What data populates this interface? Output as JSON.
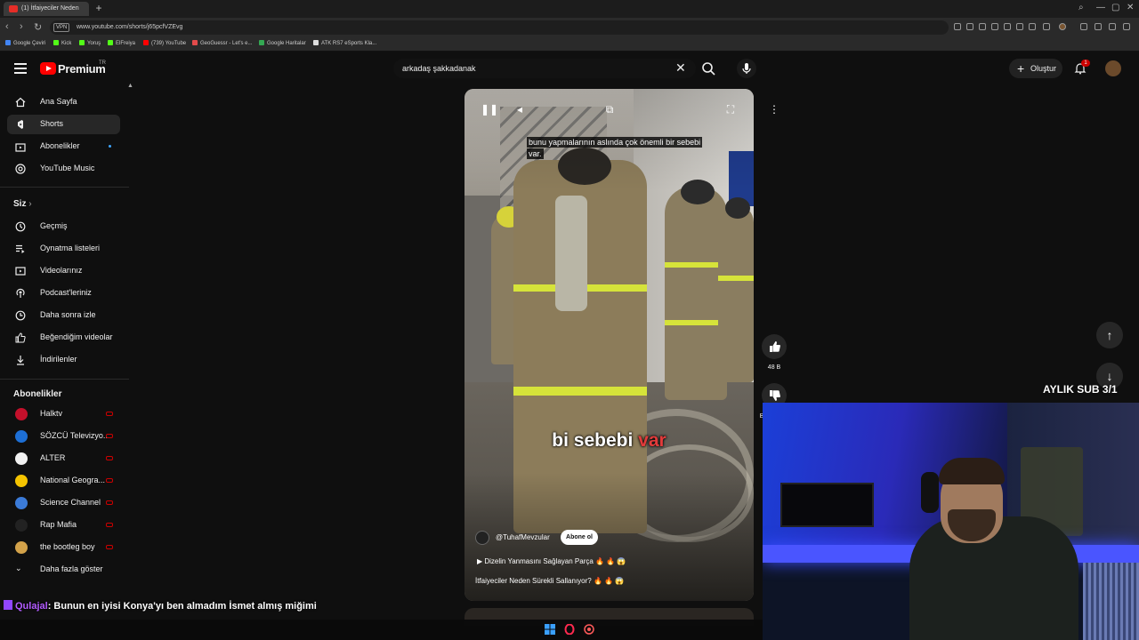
{
  "browser": {
    "tab_title": "(1) İtfaiyeciler Neden",
    "url": "www.youtube.com/shorts/j65pcfVZEvg",
    "vpn_label": "VPN",
    "bookmarks": [
      "Google Çeviri",
      "Kick",
      "Yoruş",
      "ElFreiya",
      "(739) YouTube",
      "GeoGuessr - Let's e...",
      "Google Haritalar",
      "ATK RS7 eSports Kla..."
    ]
  },
  "header": {
    "logo_text": "Premium",
    "logo_region": "TR",
    "search_query": "arkadaş şakkadanak",
    "create_label": "Oluştur",
    "notification_count": "1"
  },
  "sidebar": {
    "main": [
      {
        "label": "Ana Sayfa",
        "icon": "home-icon"
      },
      {
        "label": "Shorts",
        "icon": "shorts-icon"
      },
      {
        "label": "Abonelikler",
        "icon": "subscriptions-icon"
      },
      {
        "label": "YouTube Music",
        "icon": "music-icon"
      }
    ],
    "you_header": "Siz",
    "you": [
      {
        "label": "Geçmiş",
        "icon": "history-icon"
      },
      {
        "label": "Oynatma listeleri",
        "icon": "playlist-icon"
      },
      {
        "label": "Videolarınız",
        "icon": "your-videos-icon"
      },
      {
        "label": "Podcast'leriniz",
        "icon": "podcast-icon"
      },
      {
        "label": "Daha sonra izle",
        "icon": "clock-icon"
      },
      {
        "label": "Beğendiğim videolar",
        "icon": "like-icon"
      },
      {
        "label": "İndirilenler",
        "icon": "download-icon"
      }
    ],
    "subs_header": "Abonelikler",
    "subscriptions": [
      {
        "label": "Halktv",
        "color": "#c4102b"
      },
      {
        "label": "SÖZCÜ Televizyo...",
        "color": "#1d6fd6"
      },
      {
        "label": "ALTER",
        "color": "#f1f1f1"
      },
      {
        "label": "National Geogra...",
        "color": "#f5c400"
      },
      {
        "label": "Science Channel",
        "color": "#3b7bd8"
      },
      {
        "label": "Rap Mafia",
        "color": "#222222"
      },
      {
        "label": "the bootleg boy",
        "color": "#d3a24a"
      }
    ],
    "show_more": "Daha fazla göster"
  },
  "short": {
    "caption_top": "bunu yapmalarının aslında çok önemli bir sebebi var.",
    "caption_big": "bi sebebi",
    "caption_big_highlight": "var",
    "channel": "@TuhafMevzular",
    "subscribe": "Abone ol",
    "music": "Dizelin Yanmasını Sağlayan Parça 🔥 🔥 😱",
    "title": "İtfaiyeciler Neden Sürekli Sallanıyor? 🔥 🔥 😱",
    "like_count": "48 B",
    "dislike_label": "Be"
  },
  "overlay": {
    "sub_goal": "AYLIK SUB 3/1",
    "chat_user": "Qulajal",
    "chat_message": ": Bunun en iyisi Konya'yı ben almadım İsmet almış miğimi"
  },
  "colors": {
    "accent_red": "#ff0000",
    "bg": "#0f0f0f",
    "chat_user": "#b35cff"
  }
}
